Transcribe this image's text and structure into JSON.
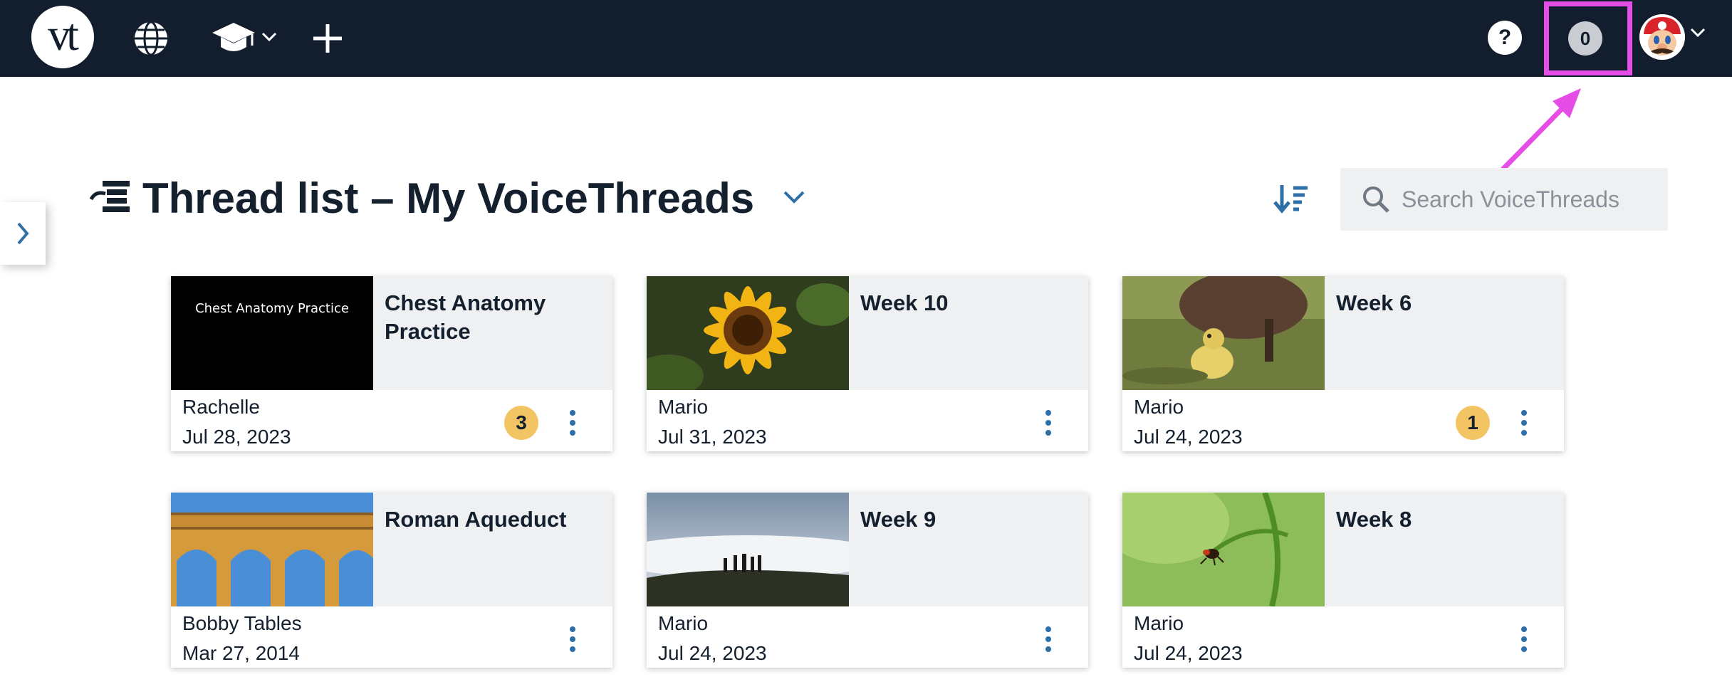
{
  "topbar": {
    "logo_text": "vt",
    "icons": [
      "globe-icon",
      "graduation-cap-icon",
      "chevron-down-icon",
      "plus-icon"
    ],
    "help_label": "?",
    "notification_count": "0"
  },
  "header": {
    "title": "Thread list – My VoiceThreads",
    "search_placeholder": "Search VoiceThreads"
  },
  "colors": {
    "topbar": "#121d2d",
    "accent": "#2e6fa8",
    "badge": "#f3c463",
    "highlight": "#e64ce6",
    "card_top": "#eef0f2"
  },
  "threads": [
    {
      "title": "Chest Anatomy Practice",
      "thumb_text": "Chest Anatomy Practice",
      "owner": "Rachelle",
      "date": "Jul 28, 2023",
      "badge": "3"
    },
    {
      "title": "Week 10",
      "owner": "Mario",
      "date": "Jul 31, 2023"
    },
    {
      "title": "Week 6",
      "owner": "Mario",
      "date": "Jul 24, 2023",
      "badge": "1"
    },
    {
      "title": "Roman Aqueduct",
      "owner": "Bobby Tables",
      "date": "Mar 27, 2014"
    },
    {
      "title": "Week 9",
      "owner": "Mario",
      "date": "Jul 24, 2023"
    },
    {
      "title": "Week 8",
      "owner": "Mario",
      "date": "Jul 24, 2023"
    }
  ]
}
